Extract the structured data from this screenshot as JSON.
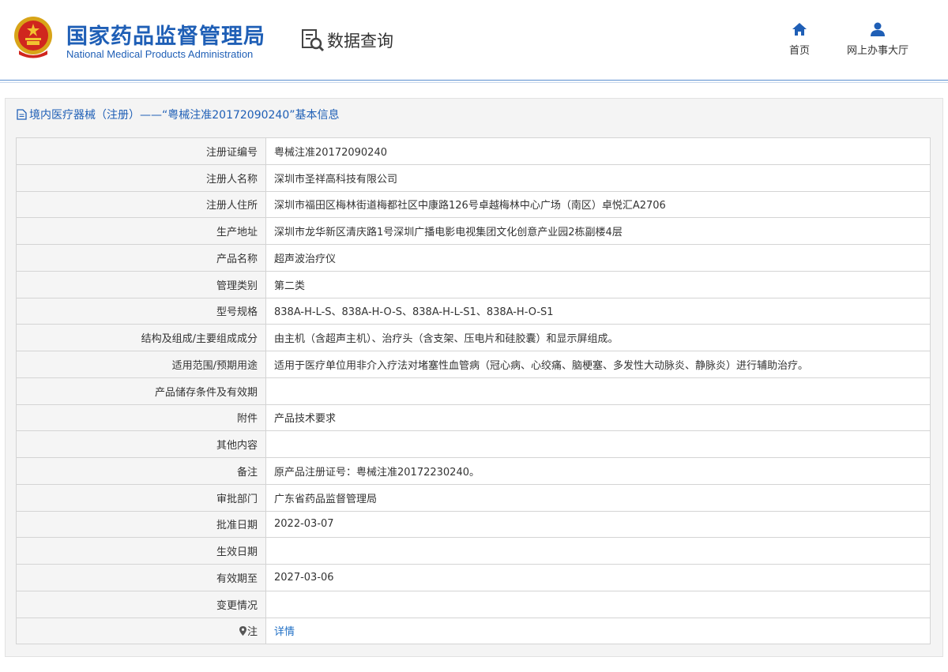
{
  "header": {
    "brand_cn": "国家药品监督管理局",
    "brand_en": "National Medical Products Administration",
    "module_title": "数据查询",
    "nav": [
      {
        "label": "首页",
        "icon": "home-icon"
      },
      {
        "label": "网上办事大厅",
        "icon": "user-icon"
      }
    ]
  },
  "panel": {
    "title": "境内医疗器械（注册）——“粤械注准20172090240”基本信息"
  },
  "rows": [
    {
      "key": "注册证编号",
      "value": "粤械注准20172090240"
    },
    {
      "key": "注册人名称",
      "value": "深圳市圣祥高科技有限公司"
    },
    {
      "key": "注册人住所",
      "value": "深圳市福田区梅林街道梅都社区中康路126号卓越梅林中心广场（南区）卓悦汇A2706"
    },
    {
      "key": "生产地址",
      "value": "深圳市龙华新区清庆路1号深圳广播电影电视集团文化创意产业园2栋副楼4层"
    },
    {
      "key": "产品名称",
      "value": "超声波治疗仪"
    },
    {
      "key": "管理类别",
      "value": "第二类"
    },
    {
      "key": "型号规格",
      "value": "838A-H-L-S、838A-H-O-S、838A-H-L-S1、838A-H-O-S1"
    },
    {
      "key": "结构及组成/主要组成成分",
      "value": "由主机（含超声主机）、治疗头（含支架、压电片和硅胶囊）和显示屏组成。"
    },
    {
      "key": "适用范围/预期用途",
      "value": "适用于医疗单位用非介入疗法对堵塞性血管病（冠心病、心绞痛、脑梗塞、多发性大动脉炎、静脉炎）进行辅助治疗。"
    },
    {
      "key": "产品储存条件及有效期",
      "value": ""
    },
    {
      "key": "附件",
      "value": "产品技术要求"
    },
    {
      "key": "其他内容",
      "value": ""
    },
    {
      "key": "备注",
      "value": "原产品注册证号：粤械注准20172230240。"
    },
    {
      "key": "审批部门",
      "value": "广东省药品监督管理局"
    },
    {
      "key": "批准日期",
      "value": "2022-03-07"
    },
    {
      "key": "生效日期",
      "value": ""
    },
    {
      "key": "有效期至",
      "value": "2027-03-06"
    },
    {
      "key": "变更情况",
      "value": ""
    }
  ],
  "note_row": {
    "key": "注",
    "link": "详情",
    "icon": "pin-icon"
  },
  "colors": {
    "brand_blue": "#1f5fb6",
    "link_blue": "#1f6fc5",
    "key_bg": "#f5f5f5",
    "border": "#d4d4d4"
  }
}
